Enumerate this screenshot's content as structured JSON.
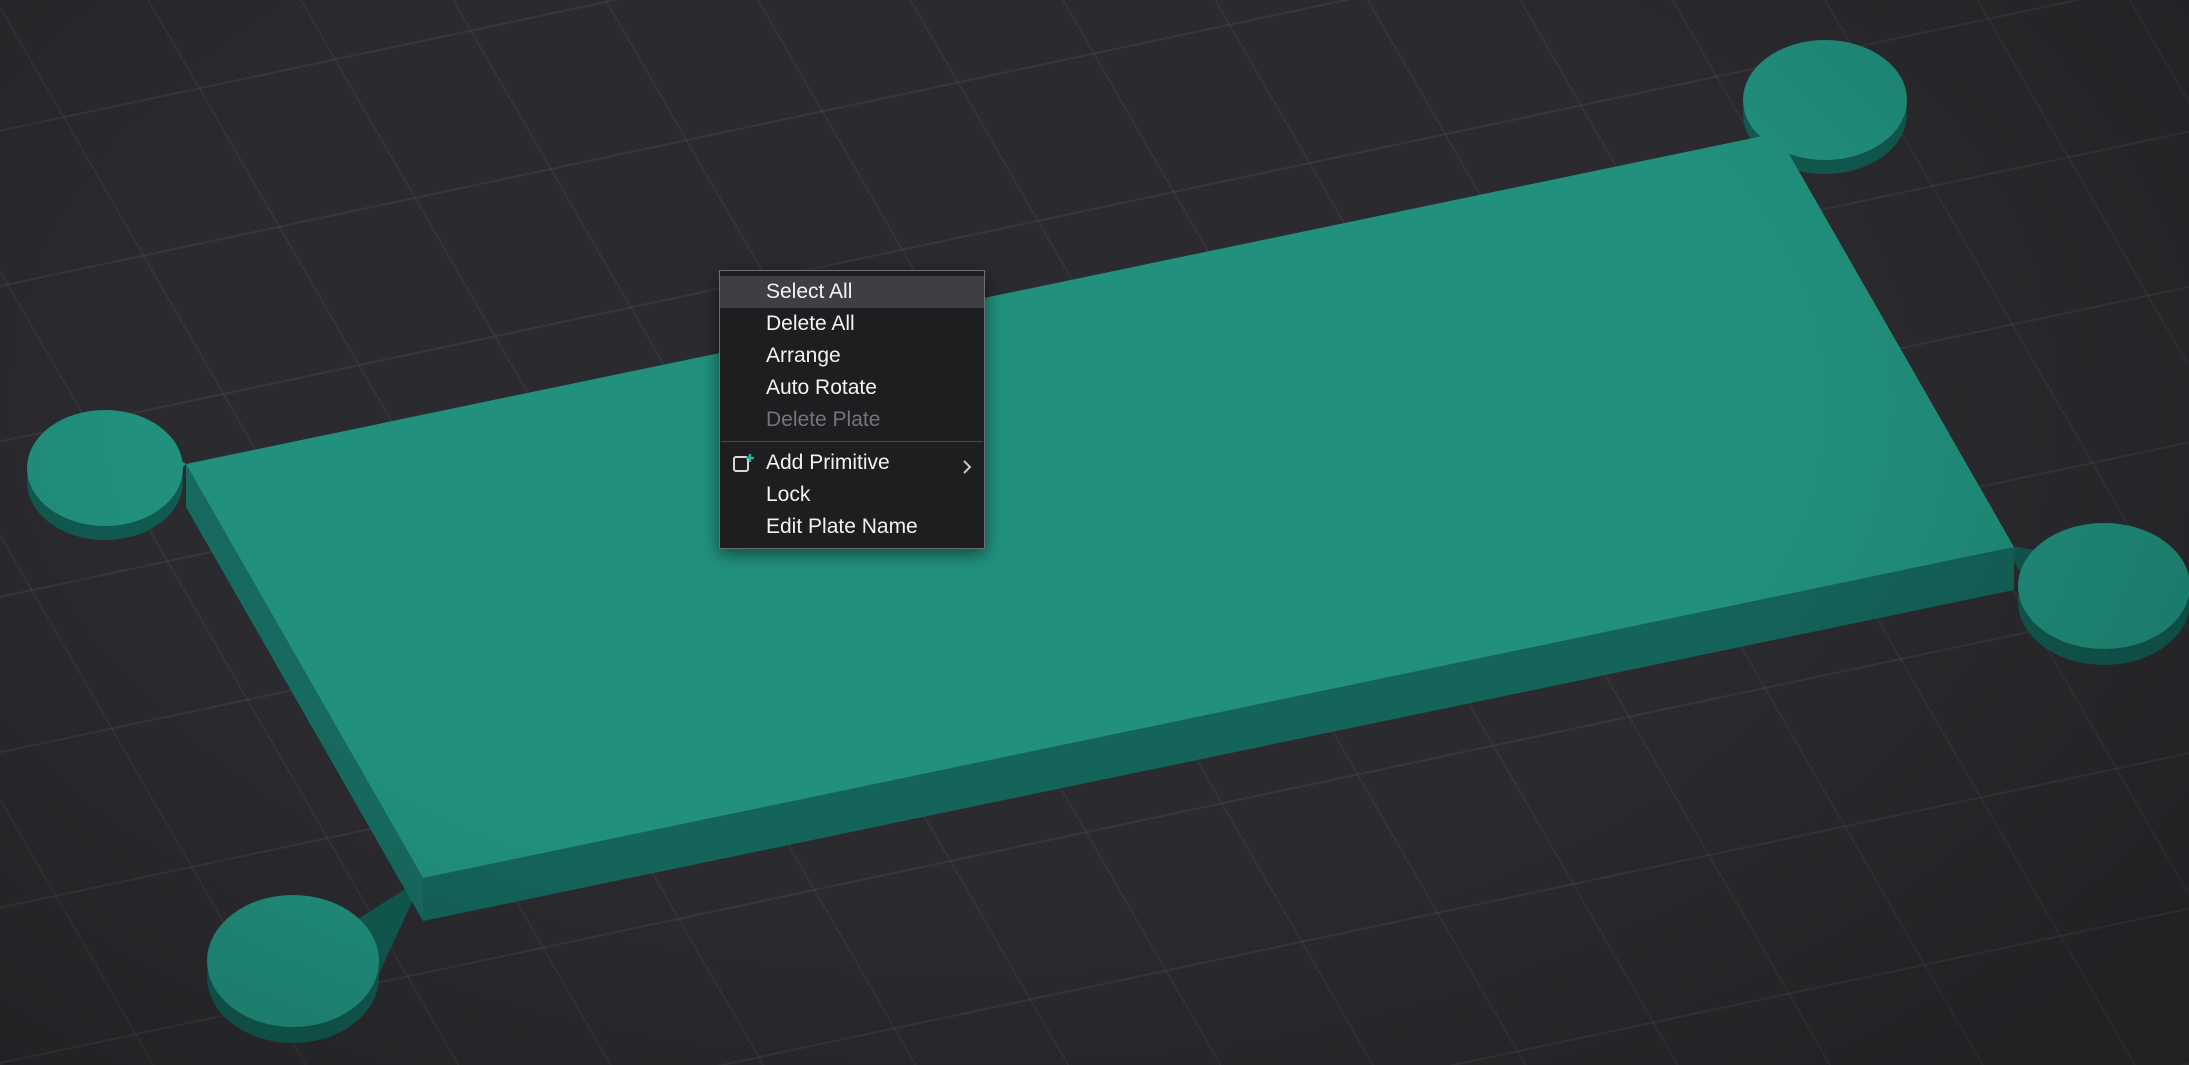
{
  "colors": {
    "viewport_bg": "#2b2b2f",
    "plate_top": "#21907d",
    "plate_front": "#14645a",
    "plate_left": "#176a5f",
    "handle": "#21907d",
    "handle_shadow": "#115a50",
    "menu_bg": "#1e1e20",
    "menu_border": "#6f6f6f",
    "menu_highlight": "#3e3e43",
    "menu_text": "#f2f2f2",
    "menu_disabled_text": "#74747a",
    "accent_plus": "#2ab49a",
    "caret": "#c8c8c8",
    "icon_stroke": "#d8d8d8"
  },
  "context_menu": {
    "items": [
      {
        "label": "Select All",
        "state": "highlighted"
      },
      {
        "label": "Delete All",
        "state": "normal"
      },
      {
        "label": "Arrange",
        "state": "normal"
      },
      {
        "label": "Auto Rotate",
        "state": "normal"
      },
      {
        "label": "Delete Plate",
        "state": "disabled"
      },
      {
        "label": "Add Primitive",
        "state": "normal",
        "icon": "add-primitive-icon",
        "has_submenu": true
      },
      {
        "label": "Lock",
        "state": "normal"
      },
      {
        "label": "Edit Plate Name",
        "state": "normal"
      }
    ]
  },
  "viewport": {
    "object": "build-plate-with-corner-handles"
  }
}
